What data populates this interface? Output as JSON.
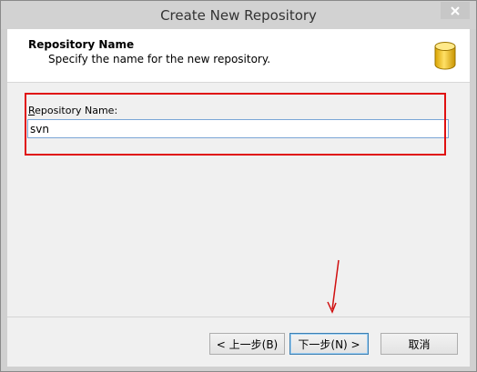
{
  "window": {
    "title": "Create New Repository"
  },
  "header": {
    "title": "Repository Name",
    "subtitle": "Specify the name for the new repository."
  },
  "form": {
    "label_mnemonic": "R",
    "label_rest": "epository Name:",
    "name_value": "svn"
  },
  "buttons": {
    "back": "< 上一步(B)",
    "next": "下一步(N) >",
    "cancel": "取消"
  },
  "colors": {
    "highlight": "#e01010",
    "arrow": "#d01010",
    "icon_fill": "#f2c21b"
  },
  "icons": {
    "close": "close-icon",
    "repository": "database-icon"
  }
}
